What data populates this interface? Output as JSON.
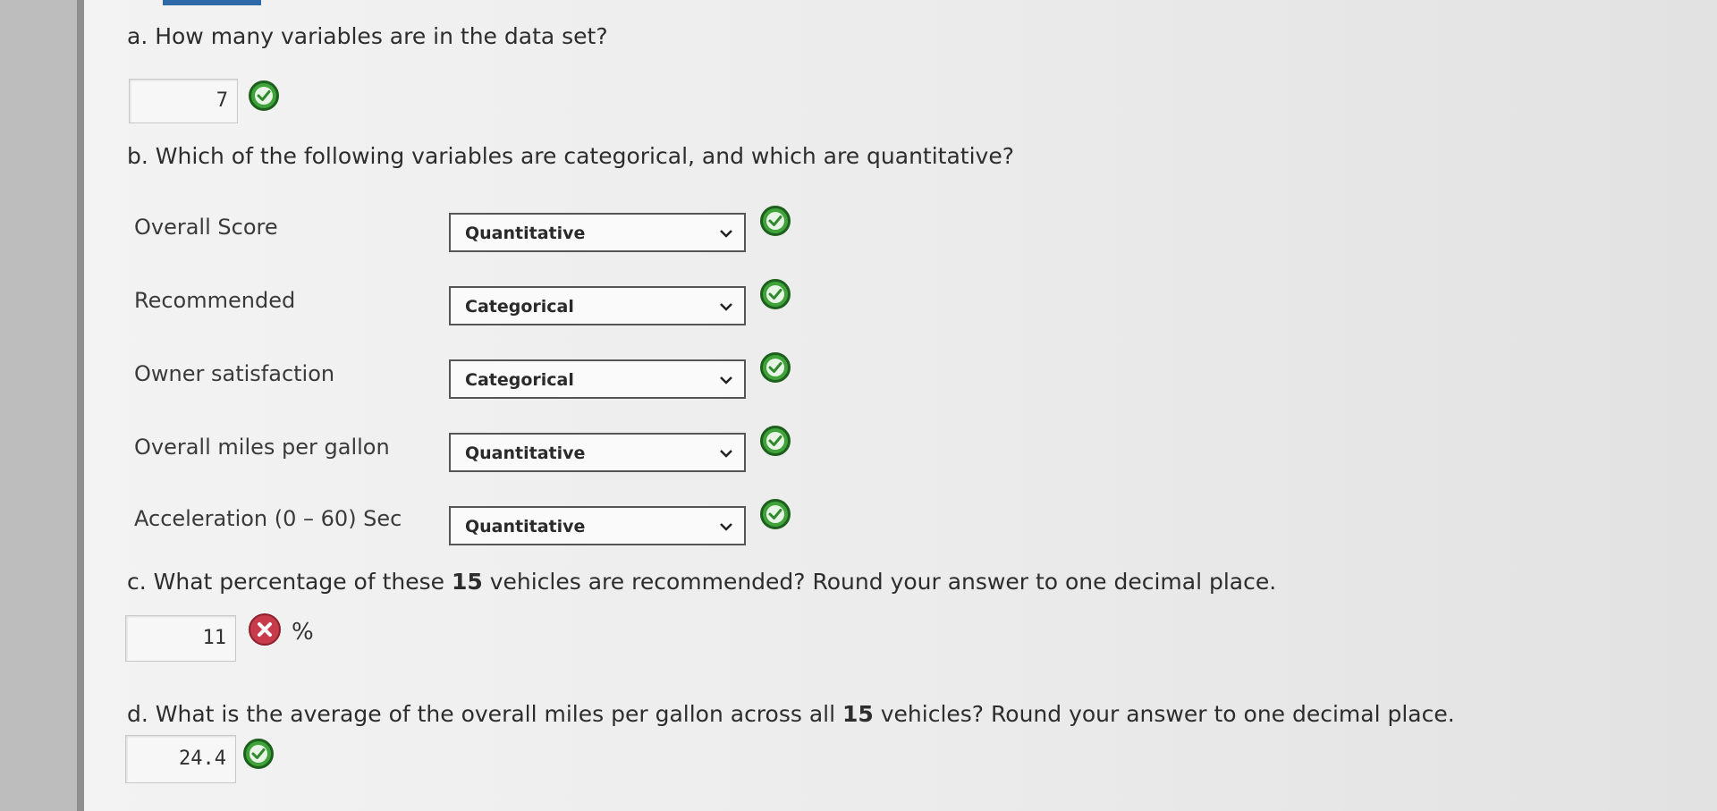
{
  "questions": {
    "a": {
      "text": "a. How many variables are in the data set?",
      "answer": "7"
    },
    "b": {
      "text": "b. Which of the following variables are categorical, and which are quantitative?"
    },
    "c": {
      "prefix": "c. What percentage of these ",
      "bold": "15",
      "suffix": " vehicles are recommended? Round your answer to one decimal place.",
      "answer": "11",
      "unit": "%"
    },
    "d": {
      "prefix": "d. What is the average of the overall miles per gallon across all ",
      "bold": "15",
      "suffix": " vehicles? Round your answer to one decimal place.",
      "answer": "24.4"
    }
  },
  "variables": [
    {
      "label": "Overall Score",
      "selected": "Quantitative"
    },
    {
      "label": "Recommended",
      "selected": "Categorical"
    },
    {
      "label": "Owner satisfaction",
      "selected": "Categorical"
    },
    {
      "label": "Overall miles per gallon",
      "selected": "Quantitative"
    },
    {
      "label": "Acceleration (0 – 60) Sec",
      "selected": "Quantitative"
    }
  ],
  "icons": {
    "correct": "check-circle-icon",
    "incorrect": "x-circle-icon",
    "dropdown": "chevron-down-icon"
  },
  "colors": {
    "correct": "#3fa33a",
    "incorrect": "#c83b4a",
    "accent": "#2f6aa8"
  }
}
